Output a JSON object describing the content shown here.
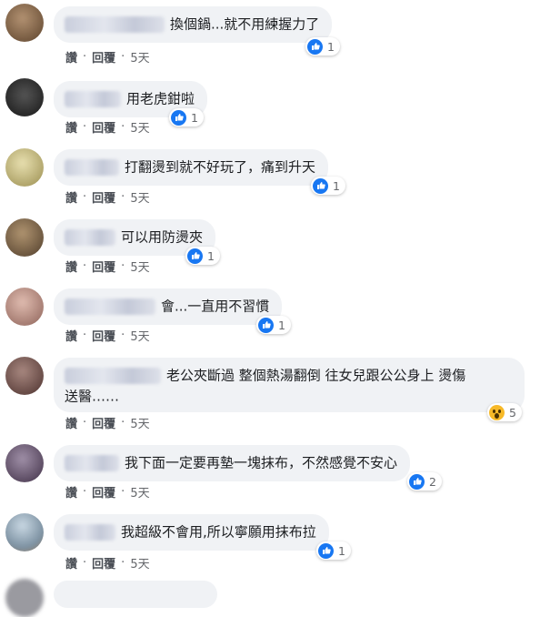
{
  "action_labels": {
    "like": "讚",
    "reply": "回覆",
    "separator": "·"
  },
  "comments": [
    {
      "text": "換個鍋...就不用練握力了",
      "reaction": "like",
      "count": "1",
      "time": "5天",
      "avatar_color": "#8a6a48"
    },
    {
      "text": "用老虎鉗啦",
      "reaction": "like",
      "count": "1",
      "time": "5天",
      "avatar_color": "#3a3a3a"
    },
    {
      "text": "打翻燙到就不好玩了，痛到升天",
      "reaction": "like",
      "count": "1",
      "time": "5天",
      "avatar_color": "#c9c089"
    },
    {
      "text": "可以用防燙夾",
      "reaction": "like",
      "count": "1",
      "time": "5天",
      "avatar_color": "#8c7350"
    },
    {
      "text": "會...一直用不習慣",
      "reaction": "like",
      "count": "1",
      "time": "5天",
      "avatar_color": "#b58a80"
    },
    {
      "text": "老公夾斷過 整個熱湯翻倒 往女兒跟公公身上 燙傷\n送醫……",
      "reaction": "wow",
      "count": "5",
      "time": "5天",
      "avatar_color": "#7a5a55"
    },
    {
      "text": "我下面一定要再墊一塊抹布，不然感覺不安心",
      "reaction": "like",
      "count": "2",
      "time": "5天",
      "avatar_color": "#6a5470"
    },
    {
      "text": "我超級不會用,所以寧願用抹布拉",
      "reaction": "like",
      "count": "1",
      "time": "5天",
      "avatar_color": "#8fa3b3"
    }
  ],
  "colors": {
    "like_blue": "#1877f2",
    "wow_yellow": "#f7b928",
    "bubble_bg": "#f0f2f5"
  }
}
